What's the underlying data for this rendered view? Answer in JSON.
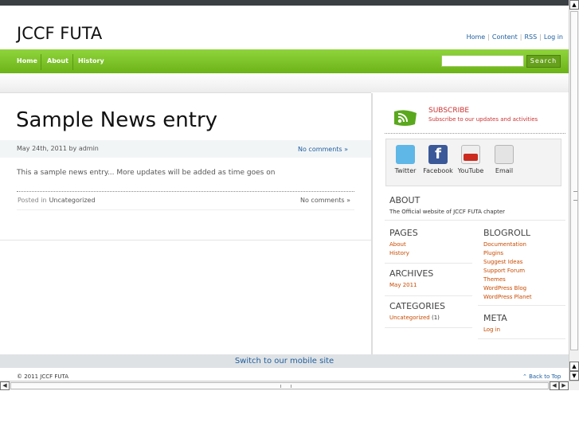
{
  "site": {
    "title": "JCCF FUTA"
  },
  "top_links": [
    "Home",
    "Content",
    "RSS",
    "Log in"
  ],
  "nav": {
    "items": [
      "Home",
      "About",
      "History"
    ],
    "search_button": "Search"
  },
  "post": {
    "title": "Sample News entry",
    "date_author": "May 24th, 2011 by admin",
    "comments": "No comments »",
    "body": "This a sample news entry... More updates will be added as time goes on",
    "posted_in_label": "Posted in",
    "category": "Uncategorized",
    "comments_bottom": "No comments »"
  },
  "subscribe": {
    "title": "SUBSCRIBE",
    "desc": "Subscribe to our updates and activities"
  },
  "social": [
    {
      "label": "Twitter",
      "icon": "twitter-icon",
      "color": "#5eb7e6"
    },
    {
      "label": "Facebook",
      "icon": "facebook-icon",
      "color": "#3b5998"
    },
    {
      "label": "YouTube",
      "icon": "youtube-icon",
      "color": "#cc2a1e"
    },
    {
      "label": "Email",
      "icon": "email-icon",
      "color": "#d8d8d8"
    }
  ],
  "about": {
    "title": "ABOUT",
    "text": "The Official website of JCCF FUTA chapter"
  },
  "pages": {
    "title": "PAGES",
    "items": [
      "About",
      "History"
    ]
  },
  "archives": {
    "title": "ARCHIVES",
    "items": [
      "May 2011"
    ]
  },
  "categories": {
    "title": "CATEGORIES",
    "item": "Uncategorized",
    "count": "(1)"
  },
  "blogroll": {
    "title": "BLOGROLL",
    "items": [
      "Documentation",
      "Plugins",
      "Suggest Ideas",
      "Support Forum",
      "Themes",
      "WordPress Blog",
      "WordPress Planet"
    ]
  },
  "meta": {
    "title": "META",
    "items": [
      "Log in"
    ]
  },
  "mobile_switch": "Switch to our mobile site",
  "footer": {
    "copyright": "© 2011 JCCF FUTA",
    "back_to_top": "⌃ Back to Top"
  },
  "colors": {
    "accent_green": "#7cc22a",
    "link_blue": "#1f5fa0",
    "widget_link": "#c84a00",
    "subscribe_red": "#cc3333"
  }
}
